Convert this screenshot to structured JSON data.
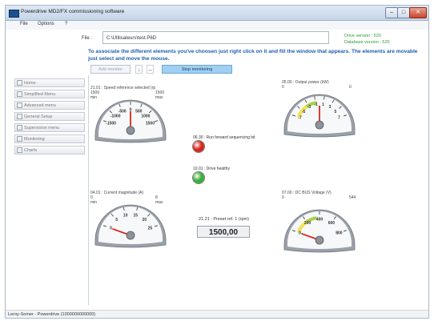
{
  "window": {
    "title": "Powerdrive MD2/FX commissioning software",
    "controls": {
      "minimize": "–",
      "maximize": "□",
      "close": "✕"
    }
  },
  "menu": [
    "File",
    "Options",
    "?"
  ],
  "file": {
    "label": "File :",
    "value": "C:\\Utilisateurs\\test.P6D"
  },
  "versions": {
    "drive": "Drive version :  520",
    "database": "Database version :  520"
  },
  "instructions": "To associate the different elements you've choosen just right click on it and fill the window that appears. The elements are movable just select and move the mouse.",
  "toolbar": {
    "add_monitor": "Add monitor",
    "stop_monitoring": "Stop monitoring"
  },
  "sidebar": {
    "items": [
      {
        "label": "Home"
      },
      {
        "label": "Simplified Menu"
      },
      {
        "label": "Advanced menu"
      },
      {
        "label": "General Setup"
      },
      {
        "label": "Supervision menu"
      },
      {
        "label": "Monitoring"
      },
      {
        "label": "Charts"
      }
    ]
  },
  "gauges": [
    {
      "title": "21.01 : Speed reference selected (rp",
      "min": "1500",
      "max": "1500",
      "min_unit": "min",
      "max_unit": "max",
      "ticks": [
        "-1500",
        "-1000",
        "-500",
        "0",
        "500",
        "1000",
        "1500"
      ],
      "value_fraction": 0.5
    },
    {
      "title": "05.00 : Output power (kW)",
      "min": "0",
      "max": "0",
      "ticks": [
        "-7",
        "-5",
        "-3",
        "-1",
        "1",
        "3",
        "5",
        "7"
      ],
      "value_fraction": 0.5
    },
    {
      "title": "04.01 : Current magnitude (A)",
      "min": "0",
      "max": "8",
      "min_unit": "min",
      "max_unit": "max",
      "ticks": [
        "0",
        "5",
        "10",
        "15",
        "20",
        "25"
      ],
      "value_fraction": 0.0
    },
    {
      "title": "07.00 : DC BUS Voltage (V)",
      "min": "0",
      "max": "544",
      "ticks": [
        "0",
        "200",
        "400",
        "600",
        "800"
      ],
      "value_fraction": 0.0
    }
  ],
  "leds": [
    {
      "label": "06.30 : Run forward sequencing bit",
      "color": "#d8261e"
    },
    {
      "label": "10.01 : Drive healthy",
      "color": "#3cae3c"
    }
  ],
  "preset": {
    "label": "21.21 : Preset ref. 1 (rpm)",
    "value": "1500,00"
  },
  "status": "Leroy-Somer - Powerdrive (1000000000000)"
}
